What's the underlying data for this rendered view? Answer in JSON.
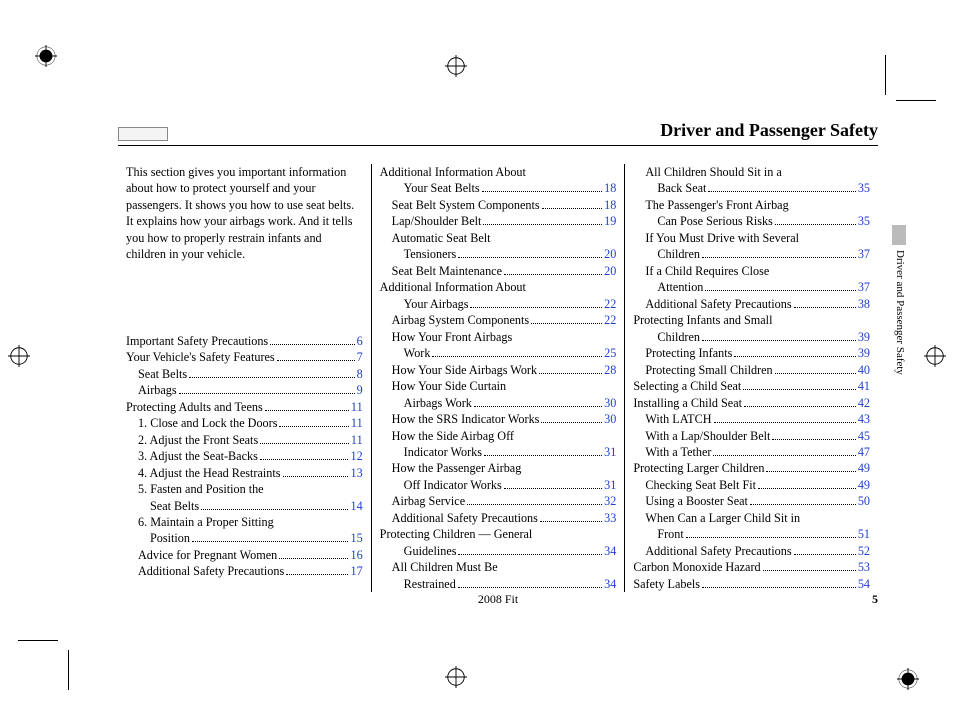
{
  "header": {
    "title": "Driver and Passenger Safety"
  },
  "intro": "This section gives you important information about how to protect yourself and your passengers. It shows you how to use seat belts. It explains how your airbags work. And it tells you how to properly restrain infants and children in your vehicle.",
  "side_label": "Driver and Passenger Safety",
  "footer": {
    "model": "2008  Fit",
    "page": "5"
  },
  "col1": [
    {
      "label": "Important Safety Precautions",
      "page": "6",
      "indent": 0
    },
    {
      "label": "Your Vehicle's Safety Features",
      "page": "7",
      "indent": 0
    },
    {
      "label": "Seat Belts",
      "page": "8",
      "indent": 1
    },
    {
      "label": "Airbags",
      "page": "9",
      "indent": 1
    },
    {
      "label": "Protecting Adults and Teens",
      "page": "11",
      "indent": 0
    },
    {
      "label": "1. Close and Lock the Doors",
      "page": "11",
      "indent": 1
    },
    {
      "label": "2. Adjust the Front Seats",
      "page": "11",
      "indent": 1
    },
    {
      "label": "3. Adjust the Seat-Backs",
      "page": "12",
      "indent": 1
    },
    {
      "label": "4. Adjust the Head Restraints",
      "page": "13",
      "indent": 1
    },
    {
      "label": "5. Fasten and Position the",
      "indent": 1,
      "wrap": true
    },
    {
      "label": "Seat Belts",
      "page": "14",
      "indent": 2
    },
    {
      "label": "6. Maintain a Proper Sitting",
      "indent": 1,
      "wrap": true
    },
    {
      "label": "Position",
      "page": "15",
      "indent": 2
    },
    {
      "label": "Advice for Pregnant Women",
      "page": "16",
      "indent": 1
    },
    {
      "label": "Additional Safety Precautions",
      "page": "17",
      "indent": 1
    }
  ],
  "col2": [
    {
      "label": "Additional Information About",
      "indent": 0,
      "wrap": true
    },
    {
      "label": "Your Seat Belts",
      "page": "18",
      "indent": 2
    },
    {
      "label": "Seat Belt System Components",
      "page": "18",
      "indent": 1
    },
    {
      "label": "Lap/Shoulder Belt",
      "page": "19",
      "indent": 1
    },
    {
      "label": "Automatic Seat Belt",
      "indent": 1,
      "wrap": true
    },
    {
      "label": "Tensioners",
      "page": "20",
      "indent": 2
    },
    {
      "label": "Seat Belt Maintenance",
      "page": "20",
      "indent": 1
    },
    {
      "label": "Additional Information About",
      "indent": 0,
      "wrap": true
    },
    {
      "label": "Your Airbags",
      "page": "22",
      "indent": 2
    },
    {
      "label": "Airbag System Components",
      "page": "22",
      "indent": 1
    },
    {
      "label": "How Your Front Airbags",
      "indent": 1,
      "wrap": true
    },
    {
      "label": "Work",
      "page": "25",
      "indent": 2
    },
    {
      "label": "How Your Side Airbags Work",
      "page": "28",
      "indent": 1
    },
    {
      "label": "How Your Side Curtain",
      "indent": 1,
      "wrap": true
    },
    {
      "label": "Airbags Work",
      "page": "30",
      "indent": 2
    },
    {
      "label": "How the SRS Indicator Works",
      "page": "30",
      "indent": 1
    },
    {
      "label": "How the Side Airbag Off",
      "indent": 1,
      "wrap": true
    },
    {
      "label": "Indicator Works",
      "page": "31",
      "indent": 2
    },
    {
      "label": "How the Passenger Airbag",
      "indent": 1,
      "wrap": true
    },
    {
      "label": "Off Indicator Works",
      "page": "31",
      "indent": 2
    },
    {
      "label": "Airbag Service",
      "page": "32",
      "indent": 1
    },
    {
      "label": "Additional Safety Precautions",
      "page": "33",
      "indent": 1
    },
    {
      "label": "Protecting Children — General",
      "indent": 0,
      "wrap": true
    },
    {
      "label": "Guidelines",
      "page": "34",
      "indent": 2
    },
    {
      "label": "All Children Must Be",
      "indent": 1,
      "wrap": true
    },
    {
      "label": "Restrained",
      "page": "34",
      "indent": 2
    }
  ],
  "col3": [
    {
      "label": "All Children Should Sit in a",
      "indent": 1,
      "wrap": true
    },
    {
      "label": "Back Seat",
      "page": "35",
      "indent": 2
    },
    {
      "label": "The Passenger's Front Airbag",
      "indent": 1,
      "wrap": true
    },
    {
      "label": "Can Pose Serious Risks",
      "page": "35",
      "indent": 2
    },
    {
      "label": "If You Must Drive with Several",
      "indent": 1,
      "wrap": true
    },
    {
      "label": "Children",
      "page": "37",
      "indent": 2
    },
    {
      "label": "If a Child Requires Close",
      "indent": 1,
      "wrap": true
    },
    {
      "label": "Attention",
      "page": "37",
      "indent": 2
    },
    {
      "label": "Additional Safety Precautions",
      "page": "38",
      "indent": 1
    },
    {
      "label": "Protecting Infants and Small",
      "indent": 0,
      "wrap": true
    },
    {
      "label": "Children",
      "page": "39",
      "indent": 2
    },
    {
      "label": "Protecting Infants",
      "page": "39",
      "indent": 1
    },
    {
      "label": "Protecting Small Children",
      "page": "40",
      "indent": 1
    },
    {
      "label": "Selecting a Child Seat",
      "page": "41",
      "indent": 0
    },
    {
      "label": "Installing a Child Seat",
      "page": "42",
      "indent": 0
    },
    {
      "label": "With LATCH",
      "page": "43",
      "indent": 1
    },
    {
      "label": "With a Lap/Shoulder Belt",
      "page": "45",
      "indent": 1
    },
    {
      "label": "With a Tether",
      "page": "47",
      "indent": 1
    },
    {
      "label": "Protecting Larger Children",
      "page": "49",
      "indent": 0
    },
    {
      "label": "Checking Seat Belt Fit",
      "page": "49",
      "indent": 1
    },
    {
      "label": "Using a Booster Seat",
      "page": "50",
      "indent": 1
    },
    {
      "label": "When Can a Larger Child Sit in",
      "indent": 1,
      "wrap": true
    },
    {
      "label": "Front",
      "page": "51",
      "indent": 2
    },
    {
      "label": "Additional Safety Precautions",
      "page": "52",
      "indent": 1
    },
    {
      "label": "Carbon Monoxide Hazard",
      "page": "53",
      "indent": 0
    },
    {
      "label": "Safety Labels",
      "page": "54",
      "indent": 0
    }
  ]
}
